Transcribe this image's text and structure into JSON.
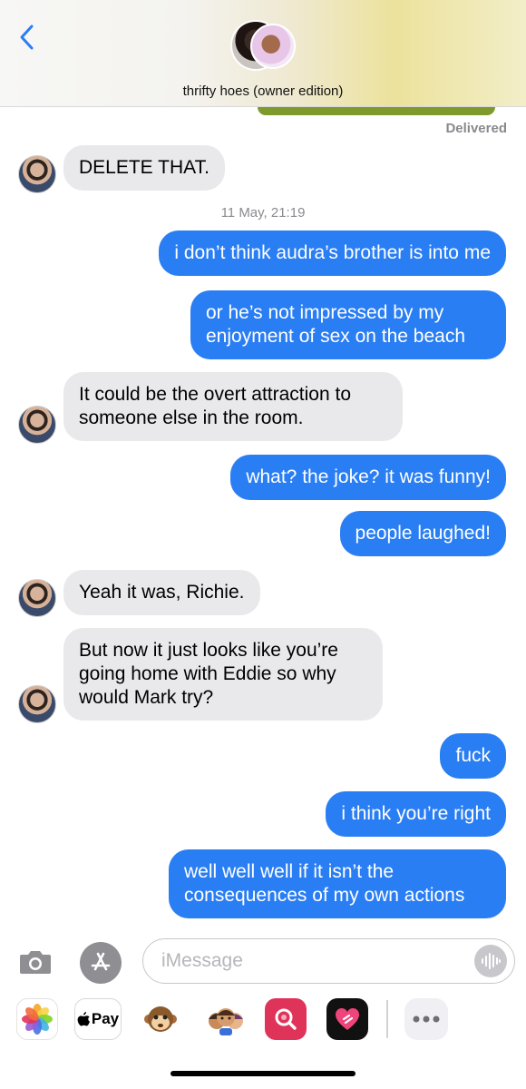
{
  "header": {
    "back_icon": "chevron-left-icon",
    "group_name": "thrifty hoes (owner edition)"
  },
  "thread": {
    "delivered_label": "Delivered",
    "timestamp": "11 May, 21:19",
    "messages": [
      {
        "direction": "in",
        "text": "DELETE THAT."
      },
      {
        "direction": "out",
        "text": "i don’t think audra’s brother is into me"
      },
      {
        "direction": "out",
        "text": "or he’s not impressed by my enjoyment of sex on the beach"
      },
      {
        "direction": "in",
        "text": "It could be the overt attraction to someone else in the room."
      },
      {
        "direction": "out",
        "text": "what? the joke? it was funny!"
      },
      {
        "direction": "out",
        "text": "people laughed!"
      },
      {
        "direction": "in",
        "text": "Yeah it was, Richie."
      },
      {
        "direction": "in",
        "text": "But now it just looks like you’re going home with Eddie so why would Mark try?"
      },
      {
        "direction": "out",
        "text": "fuck"
      },
      {
        "direction": "out",
        "text": "i think you’re right"
      },
      {
        "direction": "out",
        "text": "well well well if it isn’t the consequences of my own actions"
      }
    ]
  },
  "input_bar": {
    "placeholder": "iMessage",
    "camera_icon": "camera-icon",
    "appstore_icon": "app-store-icon",
    "audio_icon": "audio-waveform-icon"
  },
  "app_drawer": {
    "apple_pay_label": "Pay",
    "icons": [
      "photos-icon",
      "apple-pay-icon",
      "monkey-memoji-icon",
      "memoji-stickers-icon",
      "image-search-icon",
      "heart-app-icon",
      "more-apps-icon"
    ]
  },
  "colors": {
    "outgoing_bubble": "#2a7ef3",
    "incoming_bubble": "#e9e9eb",
    "meta_text": "#8a8a8e"
  }
}
